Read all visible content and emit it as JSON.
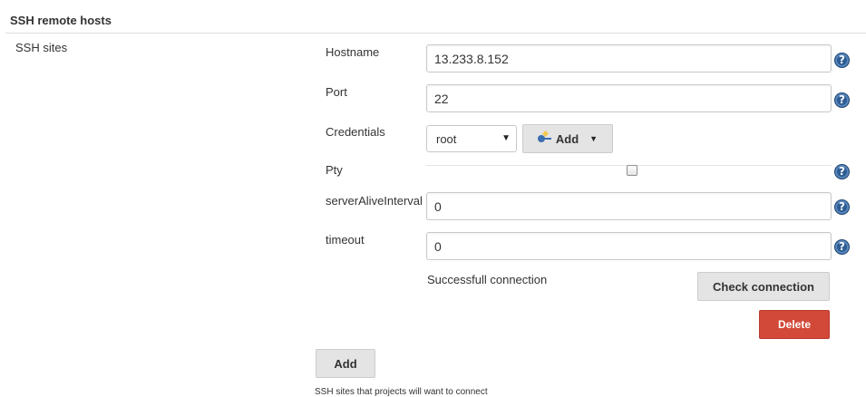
{
  "section": {
    "title": "SSH remote hosts",
    "sites_label": "SSH sites",
    "help_text": "SSH sites that projects will want to connect"
  },
  "fields": {
    "hostname": {
      "label": "Hostname",
      "value": "13.233.8.152"
    },
    "port": {
      "label": "Port",
      "value": "22"
    },
    "credentials": {
      "label": "Credentials",
      "selected": "root",
      "add_label": "Add"
    },
    "pty": {
      "label": "Pty",
      "checked": false
    },
    "server_alive_interval": {
      "label": "serverAliveInterval",
      "value": "0"
    },
    "timeout": {
      "label": "timeout",
      "value": "0"
    }
  },
  "status": {
    "message": "Successfull connection"
  },
  "buttons": {
    "check_connection": "Check connection",
    "delete": "Delete",
    "add": "Add"
  },
  "icons": {
    "help": "help-icon",
    "key": "key-icon",
    "help_glyph": "?",
    "select_arrow_glyph": "▼",
    "caret_glyph": "▼"
  },
  "colors": {
    "delete": "#d24939",
    "help_icon": "#2d5d93",
    "button_bg": "#e4e4e4"
  }
}
